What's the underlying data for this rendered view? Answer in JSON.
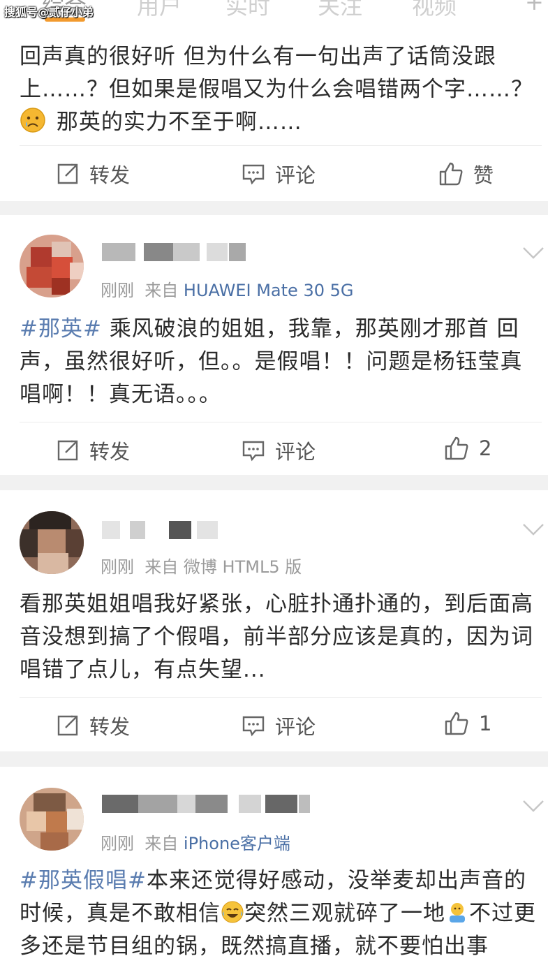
{
  "watermark": "搜狐号@贰仔小弟",
  "nav": {
    "tabs": [
      "综合",
      "用户",
      "实时",
      "关注",
      "视频"
    ]
  },
  "actions": {
    "repost": "转发",
    "comment": "评论",
    "like_text": "赞"
  },
  "posts": [
    {
      "text_parts": [
        {
          "t": "回声真的很好听 但为什么有一句出声了话筒没跟上……？但如果是假唱又为什么会唱错两个字……？"
        },
        {
          "emoji": "sad"
        },
        {
          "t": " 那英的实力不至于啊……"
        }
      ],
      "likes": "赞"
    },
    {
      "time": "刚刚",
      "from": "来自",
      "source": "HUAWEI Mate 30 5G",
      "hashtag": "#那英#",
      "text": "乘风破浪的姐姐，我靠，那英刚才那首 回声，虽然很好听，但。。是假唱！！问题是杨钰莹真唱啊！！真无语。。。",
      "likes": "2"
    },
    {
      "time": "刚刚",
      "from": "来自",
      "source": "微博 HTML5 版",
      "text": "看那英姐姐唱我好紧张，心脏扑通扑通的，到后面高音没想到搞了个假唱，前半部分应该是真的，因为词唱错了点儿，有点失望...",
      "likes": "1"
    },
    {
      "time": "刚刚",
      "from": "来自",
      "source": "iPhone客户端",
      "hashtag": "#那英假唱#",
      "text_a": "本来还觉得好感动，没举麦却出声音的时候，真是不敢相信",
      "text_b": "突然三观就碎了一地",
      "text_c": "不过更多还是节目组的锅，既然搞直播，就不要怕出事"
    }
  ],
  "colors": {
    "hashtag": "#5b7db0",
    "source": "#4a6fa5",
    "meta": "#9b9b9b",
    "separator": "#f1f1f1",
    "nav_underline": "#f29a2e"
  }
}
